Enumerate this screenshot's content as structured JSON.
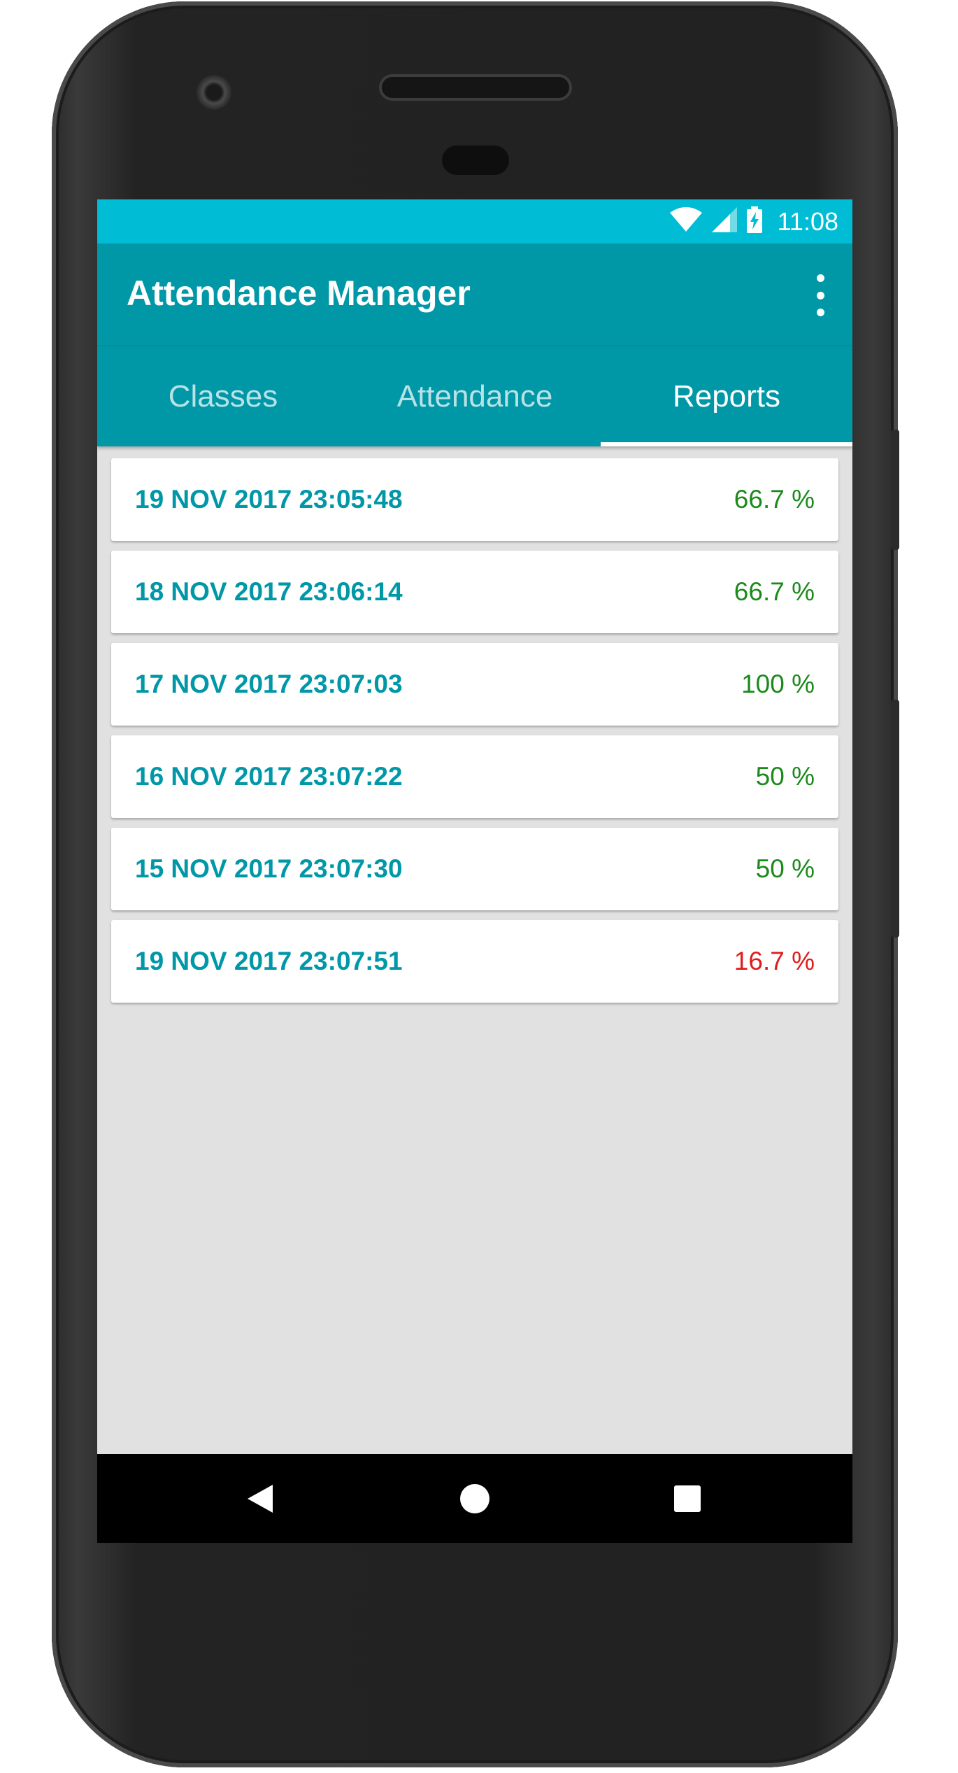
{
  "status_bar": {
    "time": "11:08",
    "icons": [
      "wifi-icon",
      "cell-signal-icon",
      "battery-charging-icon"
    ],
    "color": "#00bcd4"
  },
  "app_bar": {
    "title": "Attendance Manager",
    "menu_icon": "more-vert-icon",
    "color": "#0097a7"
  },
  "tabs": [
    {
      "label": "Classes",
      "active": false
    },
    {
      "label": "Attendance",
      "active": false
    },
    {
      "label": "Reports",
      "active": true
    }
  ],
  "reports": [
    {
      "date": "19 NOV 2017 23:05:48",
      "percent": "66.7 %",
      "status": "good"
    },
    {
      "date": "18 NOV 2017 23:06:14",
      "percent": "66.7 %",
      "status": "good"
    },
    {
      "date": "17 NOV 2017 23:07:03",
      "percent": "100 %",
      "status": "good"
    },
    {
      "date": "16 NOV 2017 23:07:22",
      "percent": "50 %",
      "status": "good"
    },
    {
      "date": "15 NOV 2017 23:07:30",
      "percent": "50 %",
      "status": "good"
    },
    {
      "date": "19 NOV 2017 23:07:51",
      "percent": "16.7 %",
      "status": "low"
    }
  ],
  "colors": {
    "date_text": "#0097a7",
    "percent_good": "#1b8a1b",
    "percent_low": "#e01b1b",
    "background": "#e1e1e1"
  },
  "nav_bar": {
    "buttons": [
      "back-icon",
      "home-icon",
      "recents-icon"
    ]
  }
}
